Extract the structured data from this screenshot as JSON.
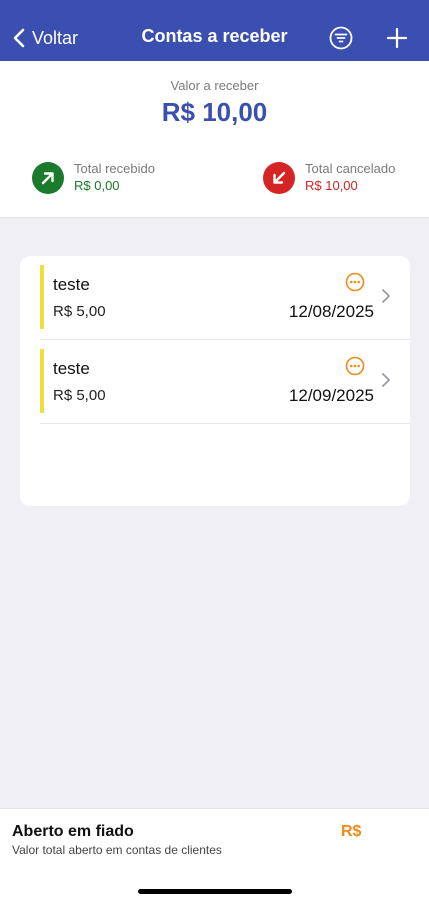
{
  "header": {
    "back_label": "Voltar",
    "title": "Contas a receber",
    "colors": {
      "background": "#3b4fb0",
      "text": "#ffffff"
    }
  },
  "summary": {
    "label": "Valor a receber",
    "value": "R$ 10,00",
    "received": {
      "label": "Total recebido",
      "value": "R$ 0,00",
      "color": "#1b7a2b",
      "icon": "arrow-up-right-icon"
    },
    "cancelled": {
      "label": "Total cancelado",
      "value": "R$ 10,00",
      "color": "#d42424",
      "icon": "arrow-down-left-icon"
    }
  },
  "items": [
    {
      "name": "teste",
      "amount": "R$ 5,00",
      "date": "12/08/2025"
    },
    {
      "name": "teste",
      "amount": "R$ 5,00",
      "date": "12/09/2025"
    }
  ],
  "footer": {
    "title": "Aberto em fiado",
    "subtitle": "Valor total aberto em contas de clientes",
    "value": "R$",
    "value_color": "#f08a1c"
  },
  "colors": {
    "status_bar": "#f1df3b",
    "accent": "#3b4fb0",
    "more_icon": "#f08a1c"
  }
}
